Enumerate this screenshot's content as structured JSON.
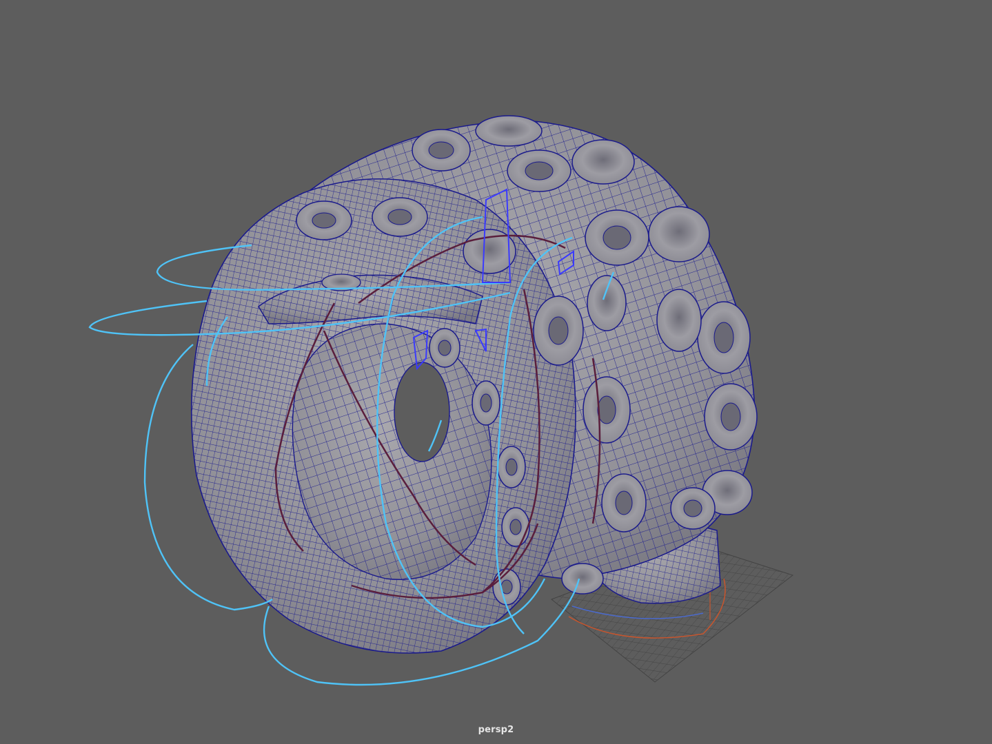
{
  "viewport": {
    "camera_name": "persp2",
    "background_color": "#5d5d5d"
  },
  "scene": {
    "mesh_fill": "#9b9a9e",
    "mesh_shade": "#7f7e86",
    "wireframe_color": "#1a1a8c",
    "nurbs_curve_color": "#4fc3f7",
    "selected_curve_color": "#3a3aff",
    "joint_color": "#5a1e3c",
    "grid_color": "#3f3f3f",
    "axis_x_color": "#c8552d",
    "axis_z_color": "#4a6ad0"
  }
}
